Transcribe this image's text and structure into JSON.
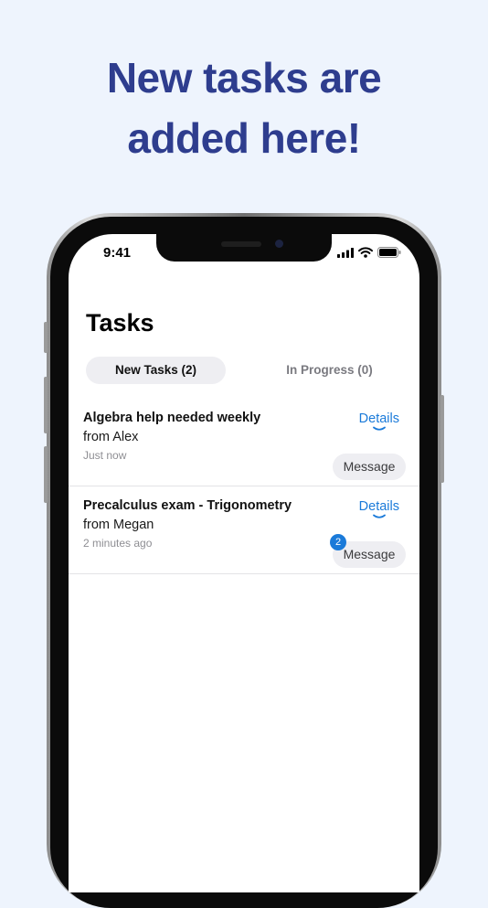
{
  "promo": {
    "line1": "New tasks are",
    "line2": "added here!",
    "color": "#2e3d8e"
  },
  "status_bar": {
    "time": "9:41",
    "icons": [
      "signal-icon",
      "wifi-icon",
      "battery-icon"
    ]
  },
  "screen": {
    "title": "Tasks",
    "tabs": [
      {
        "label": "New Tasks (2)",
        "active": true
      },
      {
        "label": "In Progress (0)",
        "active": false
      }
    ],
    "tasks": [
      {
        "title": "Algebra help needed weekly",
        "from": "from Alex",
        "time": "Just now",
        "details_label": "Details",
        "message_label": "Message",
        "unread": null
      },
      {
        "title": "Precalculus exam - Trigonometry",
        "from": "from Megan",
        "time": "2 minutes ago",
        "details_label": "Details",
        "message_label": "Message",
        "unread": "2"
      }
    ]
  },
  "colors": {
    "background": "#eef4fd",
    "accent": "#1a7ad9",
    "pill": "#eeeef2"
  }
}
